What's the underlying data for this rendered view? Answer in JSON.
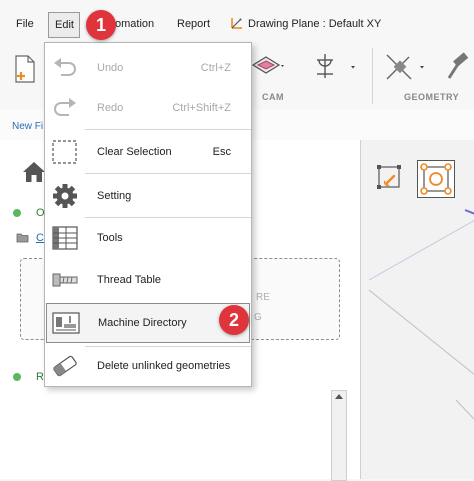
{
  "menubar": {
    "file": "File",
    "edit": "Edit",
    "automation": "omation",
    "report": "Report",
    "drawing_plane": "Drawing Plane : Default XY"
  },
  "toolbar": {
    "cam_label": "CAM",
    "geometry_label": "GEOMETRY"
  },
  "tabrow": {
    "tab_label": "New Fi"
  },
  "left_panel": {
    "row1_text": "O",
    "row2_text": "C",
    "row3_text": "R",
    "dashed_text_a": "RE",
    "dashed_text_b": "G"
  },
  "edit_menu": {
    "items": [
      {
        "label": "Undo",
        "shortcut": "Ctrl+Z",
        "icon": "undo-icon",
        "enabled": false
      },
      {
        "label": "Redo",
        "shortcut": "Ctrl+Shift+Z",
        "icon": "redo-icon",
        "enabled": false
      },
      {
        "label": "Clear Selection",
        "shortcut": "Esc",
        "icon": "clear-selection-icon",
        "enabled": true
      },
      {
        "label": "Setting",
        "shortcut": "",
        "icon": "gear-icon",
        "enabled": true
      },
      {
        "label": "Tools",
        "shortcut": "",
        "icon": "tools-table-icon",
        "enabled": true
      },
      {
        "label": "Thread Table",
        "shortcut": "",
        "icon": "thread-icon",
        "enabled": true
      },
      {
        "label": "Machine Directory",
        "shortcut": "",
        "icon": "machine-icon",
        "enabled": true
      },
      {
        "label": "Delete unlinked geometries",
        "shortcut": "",
        "icon": "eraser-icon",
        "enabled": true
      }
    ]
  },
  "callouts": {
    "first": "1",
    "second": "2"
  },
  "colors": {
    "callout": "#e0343c",
    "accent_orange": "#f08a24",
    "status_green": "#5cb85c",
    "link_blue": "#2b6cb0"
  }
}
